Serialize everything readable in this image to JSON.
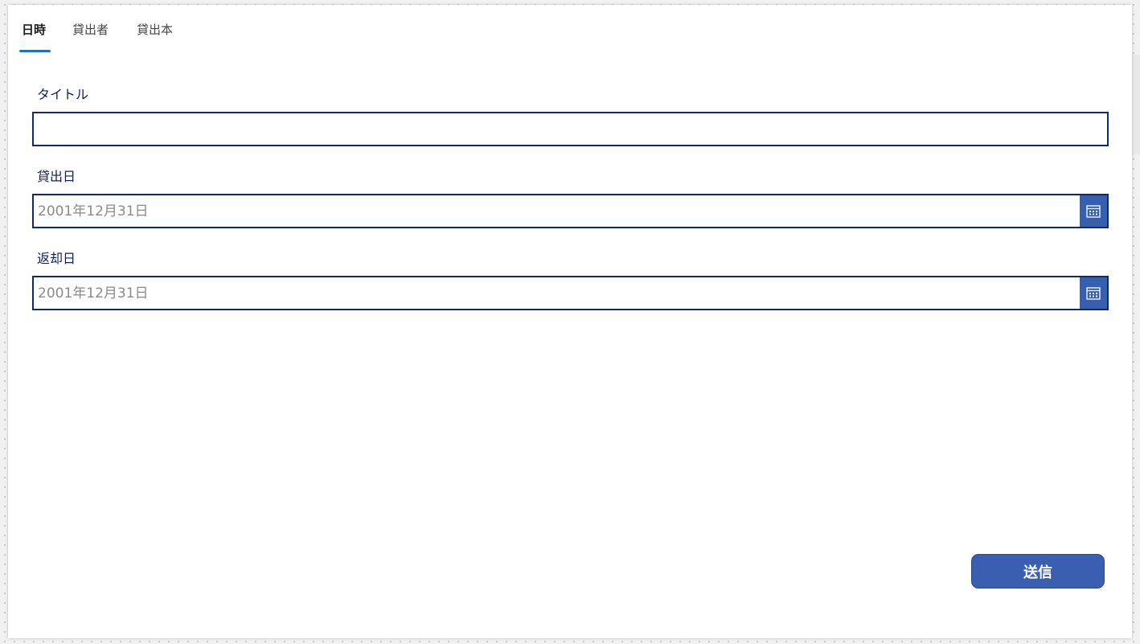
{
  "tabs": [
    {
      "label": "日時",
      "active": true
    },
    {
      "label": "貸出者",
      "active": false
    },
    {
      "label": "貸出本",
      "active": false
    }
  ],
  "form": {
    "title": {
      "label": "タイトル",
      "value": ""
    },
    "loan_date": {
      "label": "貸出日",
      "placeholder": "2001年12月31日",
      "icon": "calendar-icon"
    },
    "return_date": {
      "label": "返却日",
      "placeholder": "2001年12月31日",
      "icon": "calendar-icon"
    }
  },
  "submit": {
    "label": "送信"
  },
  "colors": {
    "accent": "#1f6fc5",
    "field_border": "#112a6b",
    "button_bg": "#3a5fb0",
    "label_text": "#0f1f5c"
  }
}
